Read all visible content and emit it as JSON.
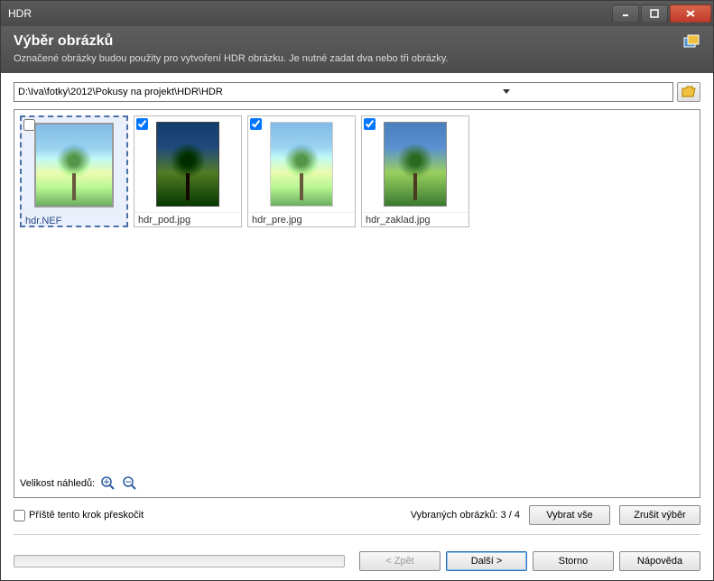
{
  "window": {
    "title": "HDR"
  },
  "header": {
    "title": "Výběr obrázků",
    "subtitle": "Označené obrázky budou použity pro vytvoření HDR obrázku. Je nutné zadat dva nebo tři obrázky."
  },
  "path": {
    "value": "D:\\Iva\\fotky\\2012\\Pokusy na projekt\\HDR\\HDR"
  },
  "thumbnails": [
    {
      "filename": "hdr.NEF",
      "checked": false,
      "selected": true
    },
    {
      "filename": "hdr_pod.jpg",
      "checked": true,
      "selected": false
    },
    {
      "filename": "hdr_pre.jpg",
      "checked": true,
      "selected": false
    },
    {
      "filename": "hdr_zaklad.jpg",
      "checked": true,
      "selected": false
    }
  ],
  "thumbSize": {
    "label": "Velikost náhledů:"
  },
  "skip": {
    "label": "Příště tento krok přeskočit",
    "checked": false
  },
  "status": {
    "selected_label": "Vybraných obrázků: 3 / 4"
  },
  "buttons": {
    "select_all": "Vybrat vše",
    "clear_selection": "Zrušit výběr",
    "back": "< Zpět",
    "next": "Další >",
    "cancel": "Storno",
    "help": "Nápověda"
  }
}
